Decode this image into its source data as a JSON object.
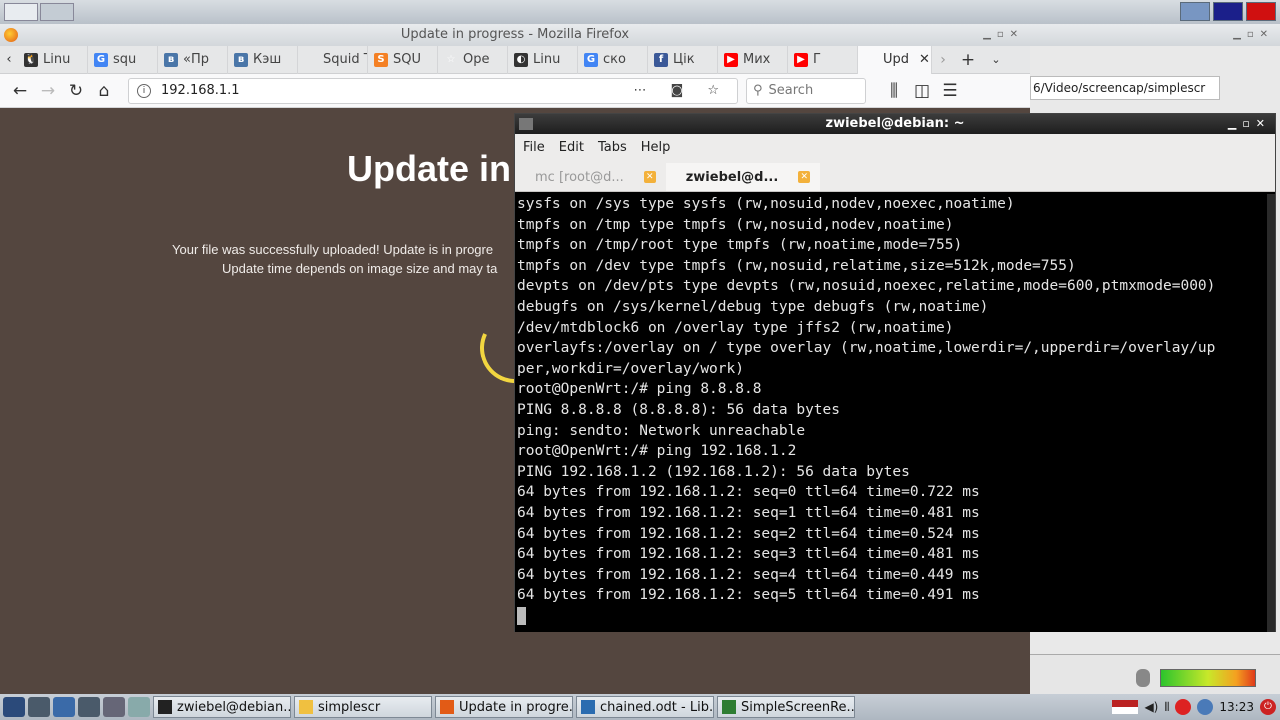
{
  "firefox": {
    "title": "Update in progress - Mozilla Firefox",
    "tabs": [
      {
        "label": "Linu",
        "fav_color": "#333333",
        "fav_glyph": "🐧"
      },
      {
        "label": "squ",
        "fav_color": "#4285f4",
        "fav_glyph": "G"
      },
      {
        "label": "«Пр",
        "fav_color": "#4a76a8",
        "fav_glyph": "в"
      },
      {
        "label": "Кэш",
        "fav_color": "#4a76a8",
        "fav_glyph": "в"
      },
      {
        "label": "Squid T",
        "fav_color": "#e6e7e8",
        "fav_glyph": ""
      },
      {
        "label": "SQU",
        "fav_color": "#f48024",
        "fav_glyph": "S"
      },
      {
        "label": "Оре",
        "fav_color": "#e6e7e8",
        "fav_glyph": "☆"
      },
      {
        "label": "Linu",
        "fav_color": "#333333",
        "fav_glyph": "◐"
      },
      {
        "label": "ско",
        "fav_color": "#4285f4",
        "fav_glyph": "G"
      },
      {
        "label": "Цік",
        "fav_color": "#3b5998",
        "fav_glyph": "f"
      },
      {
        "label": "Мих",
        "fav_color": "#ff0000",
        "fav_glyph": "▶"
      },
      {
        "label": "Г",
        "fav_color": "#ff0000",
        "fav_glyph": "▶"
      },
      {
        "label": "Upd",
        "fav_color": "#f9f9fa",
        "fav_glyph": ""
      }
    ],
    "url": "192.168.1.1",
    "search_placeholder": "Search",
    "page": {
      "heading": "Update in",
      "line1": "Your file was successfully uploaded! Update is in progre",
      "line2": "Update time depends on image size and may ta"
    }
  },
  "bg_window": {
    "path": "6/Video/screencap/simplescr"
  },
  "terminal": {
    "title": "zwiebel@debian: ~",
    "menu": [
      "File",
      "Edit",
      "Tabs",
      "Help"
    ],
    "tabs": [
      "mc [root@d...",
      "zwiebel@d..."
    ],
    "lines": [
      "sysfs on /sys type sysfs (rw,nosuid,nodev,noexec,noatime)",
      "tmpfs on /tmp type tmpfs (rw,nosuid,nodev,noatime)",
      "tmpfs on /tmp/root type tmpfs (rw,noatime,mode=755)",
      "tmpfs on /dev type tmpfs (rw,nosuid,relatime,size=512k,mode=755)",
      "devpts on /dev/pts type devpts (rw,nosuid,noexec,relatime,mode=600,ptmxmode=000)",
      "debugfs on /sys/kernel/debug type debugfs (rw,noatime)",
      "/dev/mtdblock6 on /overlay type jffs2 (rw,noatime)",
      "overlayfs:/overlay on / type overlay (rw,noatime,lowerdir=/,upperdir=/overlay/up",
      "per,workdir=/overlay/work)",
      "root@OpenWrt:/# ping 8.8.8.8",
      "PING 8.8.8.8 (8.8.8.8): 56 data bytes",
      "ping: sendto: Network unreachable",
      "root@OpenWrt:/# ping 192.168.1.2",
      "PING 192.168.1.2 (192.168.1.2): 56 data bytes",
      "64 bytes from 192.168.1.2: seq=0 ttl=64 time=0.722 ms",
      "64 bytes from 192.168.1.2: seq=1 ttl=64 time=0.481 ms",
      "64 bytes from 192.168.1.2: seq=2 ttl=64 time=0.524 ms",
      "64 bytes from 192.168.1.2: seq=3 ttl=64 time=0.481 ms",
      "64 bytes from 192.168.1.2: seq=4 ttl=64 time=0.449 ms",
      "64 bytes from 192.168.1.2: seq=5 ttl=64 time=0.491 ms"
    ]
  },
  "taskbar": {
    "tasks": [
      {
        "label": "zwiebel@debian...",
        "icon_color": "#222222"
      },
      {
        "label": "simplescr",
        "icon_color": "#f0c040"
      },
      {
        "label": "Update in progre...",
        "icon_color": "#e25b16"
      },
      {
        "label": "chained.odt - Lib...",
        "icon_color": "#2b6cb0"
      },
      {
        "label": "SimpleScreenRe...",
        "icon_color": "#2e7d32"
      }
    ],
    "clock": "13:23"
  }
}
